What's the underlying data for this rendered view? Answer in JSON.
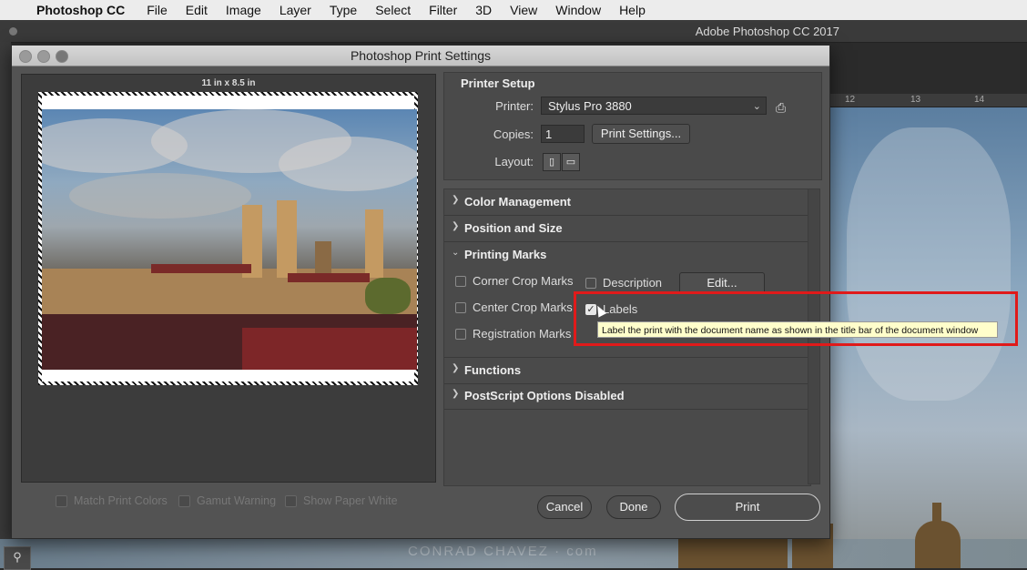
{
  "menubar": {
    "app_name": "Photoshop CC",
    "items": [
      "File",
      "Edit",
      "Image",
      "Layer",
      "Type",
      "Select",
      "Filter",
      "3D",
      "View",
      "Window",
      "Help"
    ]
  },
  "app": {
    "title": "Adobe Photoshop CC 2017"
  },
  "ruler": {
    "ticks": [
      "12",
      "13",
      "14"
    ]
  },
  "dialog": {
    "title": "Photoshop Print Settings",
    "preview": {
      "paper_size": "11 in x 8.5 in"
    },
    "bottom_checks": [
      {
        "label": "Match Print Colors"
      },
      {
        "label": "Gamut Warning"
      },
      {
        "label": "Show Paper White"
      }
    ],
    "printer_setup": {
      "title": "Printer Setup",
      "printer_label": "Printer:",
      "printer_value": "Stylus Pro 3880",
      "copies_label": "Copies:",
      "copies_value": "1",
      "print_settings_button": "Print Settings...",
      "layout_label": "Layout:"
    },
    "sections": {
      "color_management": "Color Management",
      "position_and_size": "Position and Size",
      "printing_marks": "Printing Marks",
      "functions": "Functions",
      "postscript": "PostScript Options Disabled"
    },
    "printing_marks": {
      "corner_crop": "Corner Crop Marks",
      "center_crop": "Center Crop Marks",
      "registration": "Registration Marks",
      "description": "Description",
      "labels": "Labels",
      "edit_button": "Edit..."
    },
    "tooltip": "Label the print with the document name as shown in the title bar of the document window",
    "buttons": {
      "cancel": "Cancel",
      "done": "Done",
      "print": "Print"
    }
  },
  "watermark": "CONRAD CHAVEZ · com",
  "colors": {
    "highlight": "#e01a1a",
    "tooltip_bg": "#fffecb"
  }
}
